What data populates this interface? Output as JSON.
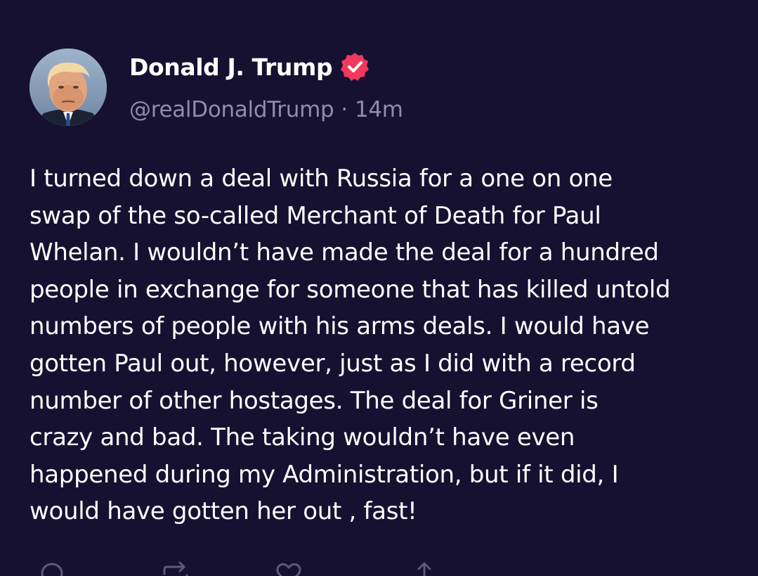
{
  "author": {
    "display_name": "Donald J. Trump",
    "handle": "@realDonaldTrump",
    "separator": "·",
    "timestamp": "14m",
    "verified_color": "#f2385d"
  },
  "post": {
    "lines": [
      "I turned down a deal with Russia for a one on one",
      "swap of the so-called Merchant of Death for Paul",
      "Whelan. I wouldn’t have made the deal for a hundred",
      "people in exchange for someone that has killed untold",
      "numbers of people with his arms deals. I would have",
      "gotten Paul out, however, just as I did with a record",
      "number of other hostages. The deal for Griner is",
      "crazy and bad. The taking wouldn’t have even",
      "happened during my Administration, but if it did, I",
      "would have gotten her out , fast!"
    ]
  },
  "actions": {
    "reply_icon": "reply-icon",
    "retruth_icon": "retruth-icon",
    "like_icon": "heart-icon",
    "share_icon": "share-icon"
  },
  "colors": {
    "background": "#161131",
    "muted_text": "#918bb0",
    "primary_text": "#ffffff"
  }
}
